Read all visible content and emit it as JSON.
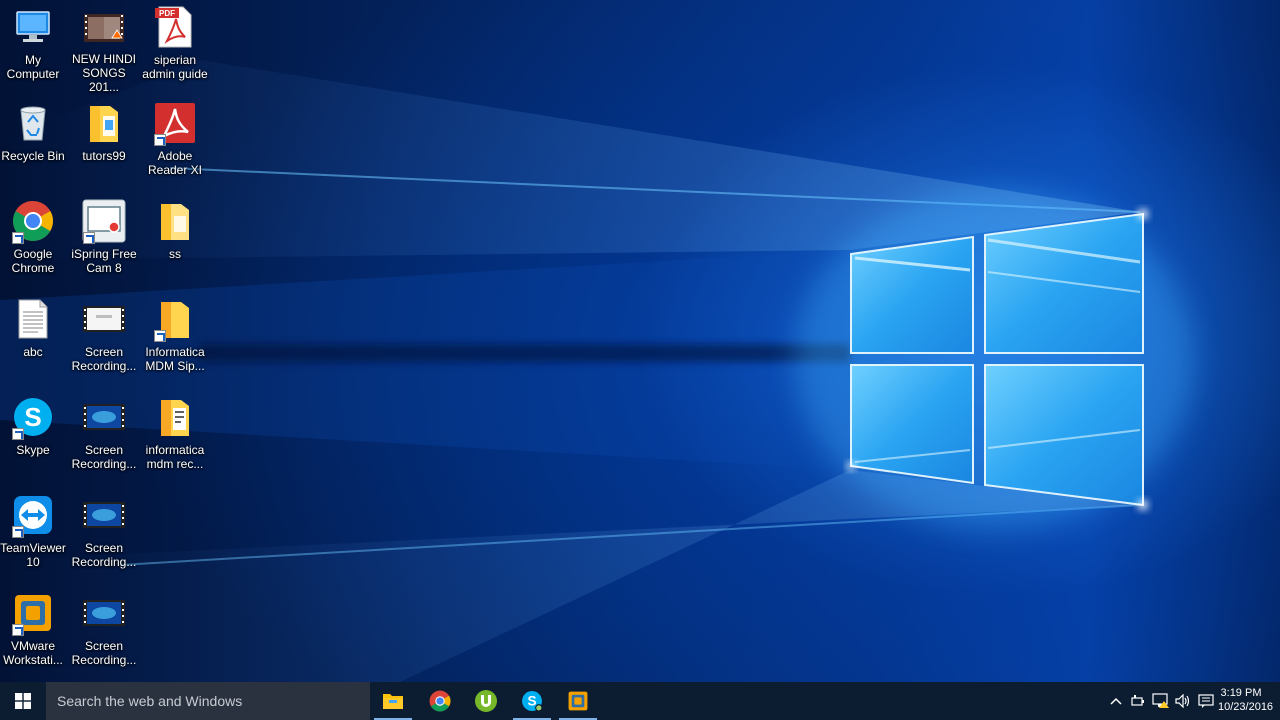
{
  "desktop": {
    "icons": [
      {
        "id": "my-computer",
        "label": "My\nComputer"
      },
      {
        "id": "new-hindi-songs",
        "label": "NEW HINDI\nSONGS 201..."
      },
      {
        "id": "siperian-admin-guide",
        "label": "siperian\nadmin guide"
      },
      {
        "id": "recycle-bin",
        "label": "Recycle Bin"
      },
      {
        "id": "tutors99",
        "label": "tutors99"
      },
      {
        "id": "adobe-reader",
        "label": "Adobe\nReader XI"
      },
      {
        "id": "google-chrome",
        "label": "Google\nChrome"
      },
      {
        "id": "ispring-free-cam",
        "label": "iSpring Free\nCam 8"
      },
      {
        "id": "ss",
        "label": "ss"
      },
      {
        "id": "abc",
        "label": "abc"
      },
      {
        "id": "screen-recording-1",
        "label": "Screen\nRecording..."
      },
      {
        "id": "informatica-mdm-sip",
        "label": "Informatica\nMDM Sip..."
      },
      {
        "id": "skype",
        "label": "Skype"
      },
      {
        "id": "screen-recording-2",
        "label": "Screen\nRecording..."
      },
      {
        "id": "informatica-mdm-rec",
        "label": "informatica\nmdm rec..."
      },
      {
        "id": "teamviewer",
        "label": "TeamViewer\n10"
      },
      {
        "id": "screen-recording-3",
        "label": "Screen\nRecording..."
      },
      {
        "id": "vmware-workstation",
        "label": "VMware\nWorkstati..."
      },
      {
        "id": "screen-recording-4",
        "label": "Screen\nRecording..."
      }
    ],
    "pdf_badge": "PDF"
  },
  "taskbar": {
    "search_placeholder": "Search the web and Windows",
    "pinned": [
      "file-explorer",
      "google-chrome",
      "utorrent",
      "skype",
      "vmware"
    ],
    "tray": [
      "show-hidden-icons",
      "power",
      "network",
      "volume",
      "action-center"
    ],
    "clock": {
      "time": "3:19 PM",
      "date": "10/23/2016"
    }
  },
  "colors": {
    "taskbar": "#0c1c31",
    "search_box": "#2a3240",
    "wallpaper_glow": "#4db8ff",
    "wallpaper_dark": "#021236"
  }
}
